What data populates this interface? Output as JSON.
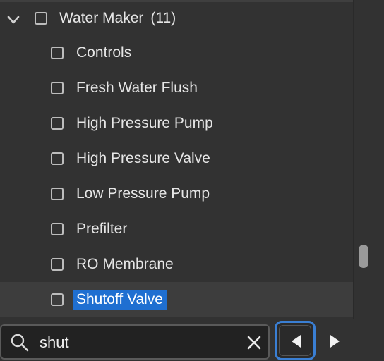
{
  "tree": {
    "group": {
      "label": "Water Maker",
      "count": "(11)"
    },
    "items": [
      {
        "label": "Controls"
      },
      {
        "label": "Fresh Water Flush"
      },
      {
        "label": "High Pressure Pump"
      },
      {
        "label": "High Pressure Valve"
      },
      {
        "label": "Low Pressure Pump"
      },
      {
        "label": "Prefilter"
      },
      {
        "label": "RO Membrane"
      },
      {
        "label": "Shutoff Valve"
      }
    ]
  },
  "search": {
    "value": "shut",
    "placeholder": ""
  },
  "icons": {
    "expand": "chevron-down-icon",
    "search": "search-icon",
    "clear": "close-icon",
    "previous": "triangle-left-icon",
    "next": "triangle-right-icon"
  },
  "colors": {
    "background": "#323232",
    "highlight": "#1f6fd1",
    "focus_ring": "#3a7fd4"
  }
}
